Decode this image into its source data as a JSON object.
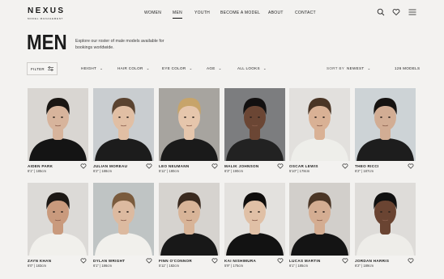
{
  "brand": {
    "name": "NEXUS",
    "tagline": "MODEL MANAGEMENT"
  },
  "nav": {
    "items": [
      {
        "label": "WOMEN",
        "active": false
      },
      {
        "label": "MEN",
        "active": true
      },
      {
        "label": "YOUTH",
        "active": false
      },
      {
        "label": "BECOME A MODEL",
        "active": false
      },
      {
        "label": "ABOUT",
        "active": false
      },
      {
        "label": "CONTACT",
        "active": false
      }
    ],
    "icons": [
      "search-icon",
      "heart-icon",
      "menu-icon"
    ]
  },
  "hero": {
    "title": "MEN",
    "description": "Explore our roster of male models available for bookings worldwide."
  },
  "filters": {
    "filter_label": "FILTER",
    "dropdowns": [
      "HEIGHT",
      "HAIR COLOR",
      "EYE COLOR",
      "AGE",
      "ALL LOOKS"
    ],
    "sort_label": "SORT BY",
    "sort_value": "NEWEST",
    "count": "126 MODELS"
  },
  "models": [
    {
      "name": "AIDEN PARK",
      "stats": "6'1\" | 185cm"
    },
    {
      "name": "JULIAN MOREAU",
      "stats": "6'2\" | 188cm"
    },
    {
      "name": "LEO NEUMANN",
      "stats": "5'11\" | 180cm"
    },
    {
      "name": "MALIK JOHNSON",
      "stats": "6'3\" | 190cm"
    },
    {
      "name": "OSCAR LEWIS",
      "stats": "5'10\" | 178cm"
    },
    {
      "name": "THEO RICCI",
      "stats": "6'2\" | 187cm"
    },
    {
      "name": "ZAYN KHAN",
      "stats": "6'0\" | 183cm"
    },
    {
      "name": "DYLAN WRIGHT",
      "stats": "6'1\" | 186cm"
    },
    {
      "name": "FINN O'CONNOR",
      "stats": "5'11\" | 182cm"
    },
    {
      "name": "KAI NISHIMURA",
      "stats": "5'9\" | 175cm"
    },
    {
      "name": "LUCAS MARTIN",
      "stats": "6'1\" | 185cm"
    },
    {
      "name": "JORDAN HARRIS",
      "stats": "6'2\" | 189cm"
    }
  ],
  "colors": {
    "background": "#f3f2f0",
    "text": "#1b1b1b",
    "border": "#cfcdca"
  }
}
